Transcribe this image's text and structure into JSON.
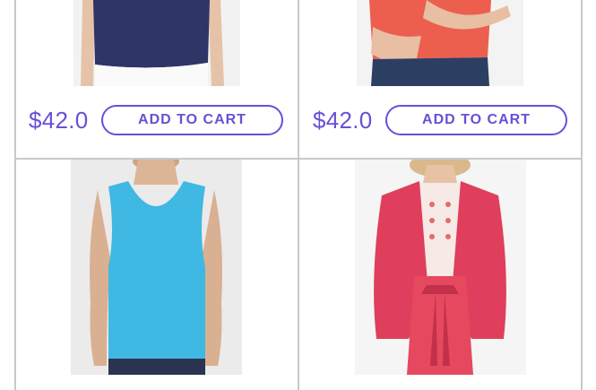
{
  "products": [
    {
      "price": "$42.0",
      "button_label": "ADD TO CART",
      "image": "navy-sleeveless-top"
    },
    {
      "price": "$42.0",
      "button_label": "ADD TO CART",
      "image": "coral-shirt-with-jeans"
    },
    {
      "image": "turquoise-tank-top"
    },
    {
      "image": "pink-blazer-and-skirt"
    }
  ],
  "colors": {
    "accent": "#6a4fd6",
    "divider": "#c8c8cc"
  }
}
